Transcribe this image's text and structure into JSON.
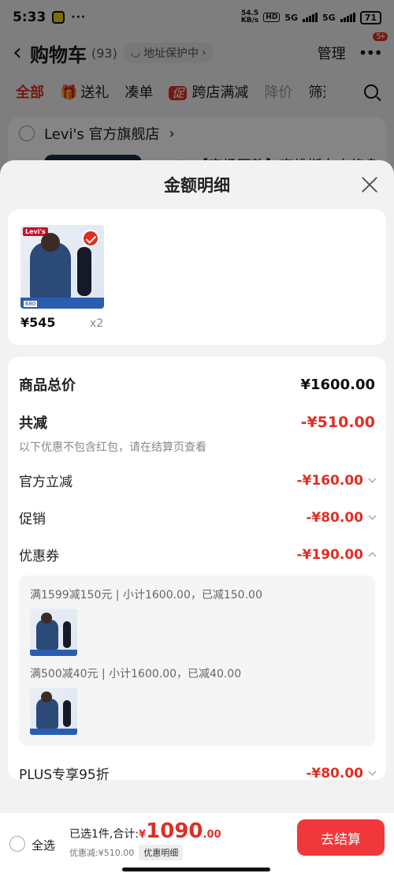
{
  "status_bar": {
    "time": "5:33",
    "dots": "···",
    "net_speed_value": "54.5",
    "net_speed_unit": "KB/s",
    "hd_label": "HD",
    "sim1_label": "5G",
    "sim2_label": "5G",
    "battery": "71"
  },
  "header": {
    "title": "购物车",
    "count": "(93)",
    "address_protect": "地址保护中",
    "manage": "管理",
    "more_badge": "5+"
  },
  "filter_tabs": {
    "all": "全部",
    "gift": "送礼",
    "bundle": "凑单",
    "promo_tag": "促",
    "cross_store": "跨店满减",
    "price_drop": "降价",
    "filter": "筛选"
  },
  "store": {
    "name": "Levi's 官方旗舰店",
    "item_title_partial": "Levi's【商场同款】李维斯女士修身"
  },
  "sheet": {
    "title": "金额明细",
    "product": {
      "brand_logo": "Levi's",
      "price": "¥545",
      "qty": "x2",
      "thumb_price_tag": "680"
    },
    "rows": {
      "total_label": "商品总价",
      "total_value": "¥1600.00",
      "reduce_label": "共减",
      "reduce_value": "-¥510.00",
      "note": "以下优惠不包含红包，请在结算页查看",
      "official_label": "官方立减",
      "official_value": "-¥160.00",
      "promo_label": "促销",
      "promo_value": "-¥80.00",
      "coupon_label": "优惠券",
      "coupon_value": "-¥190.00",
      "plus_label": "PLUS专享95折",
      "plus_value": "-¥80.00"
    },
    "coupons": [
      {
        "line": "满1599减150元 | 小计1600.00，已减150.00"
      },
      {
        "line": "满500减40元 | 小计1600.00，已减40.00"
      }
    ]
  },
  "bottom_bar": {
    "select_all": "全选",
    "selected": "已选1件,合计:",
    "currency": "¥",
    "total_int": "1090",
    "total_dec": ".00",
    "discount": "优惠减:¥510.00",
    "detail_chip": "优惠明细",
    "checkout": "去结算"
  }
}
